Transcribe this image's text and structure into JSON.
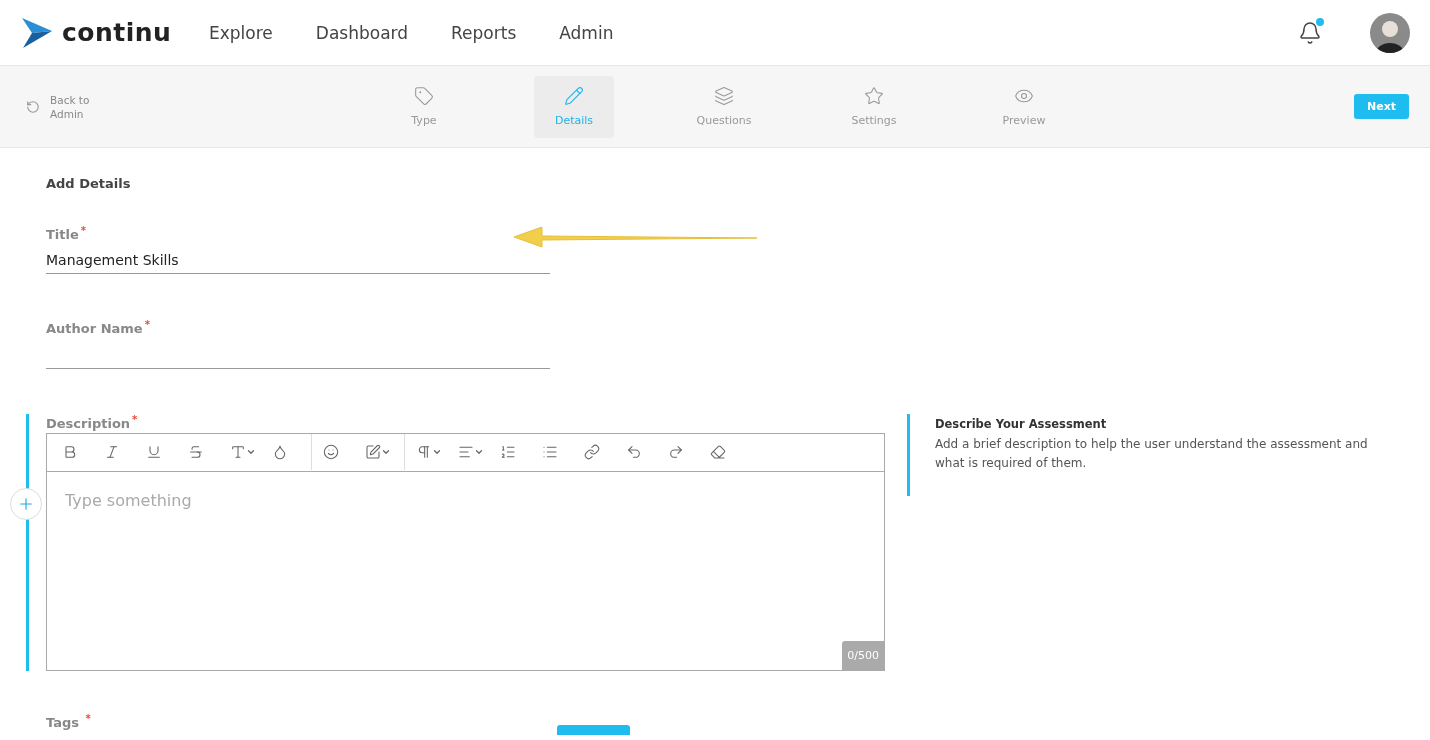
{
  "brand": {
    "name": "continu"
  },
  "nav": [
    {
      "label": "Explore"
    },
    {
      "label": "Dashboard"
    },
    {
      "label": "Reports"
    },
    {
      "label": "Admin"
    }
  ],
  "notifications": {
    "unread": true
  },
  "back": {
    "label": "Back to Admin"
  },
  "steps": [
    {
      "kind": "tag",
      "label": "Type",
      "selected": false
    },
    {
      "kind": "pencil",
      "label": "Details",
      "selected": true
    },
    {
      "kind": "layers",
      "label": "Questions",
      "selected": false
    },
    {
      "kind": "star",
      "label": "Settings",
      "selected": false
    },
    {
      "kind": "eye",
      "label": "Preview",
      "selected": false
    }
  ],
  "next_button": "Next",
  "section_title": "Add Details",
  "fields": [
    {
      "label": "Title",
      "mark": "*",
      "value": "Management Skills"
    },
    {
      "label": "Author Name",
      "mark": "*"
    }
  ],
  "description": {
    "label": "Description",
    "mark": "*",
    "placeholder": "Type something",
    "counter": "0/500",
    "active": true
  },
  "help": {
    "title": "Describe Your Assessment",
    "text": "Add a brief description to help the user understand the assessment and what is required of them."
  },
  "tags": {
    "label": "Tags",
    "mark": "*"
  },
  "annotation": {
    "kind": "arrow"
  }
}
